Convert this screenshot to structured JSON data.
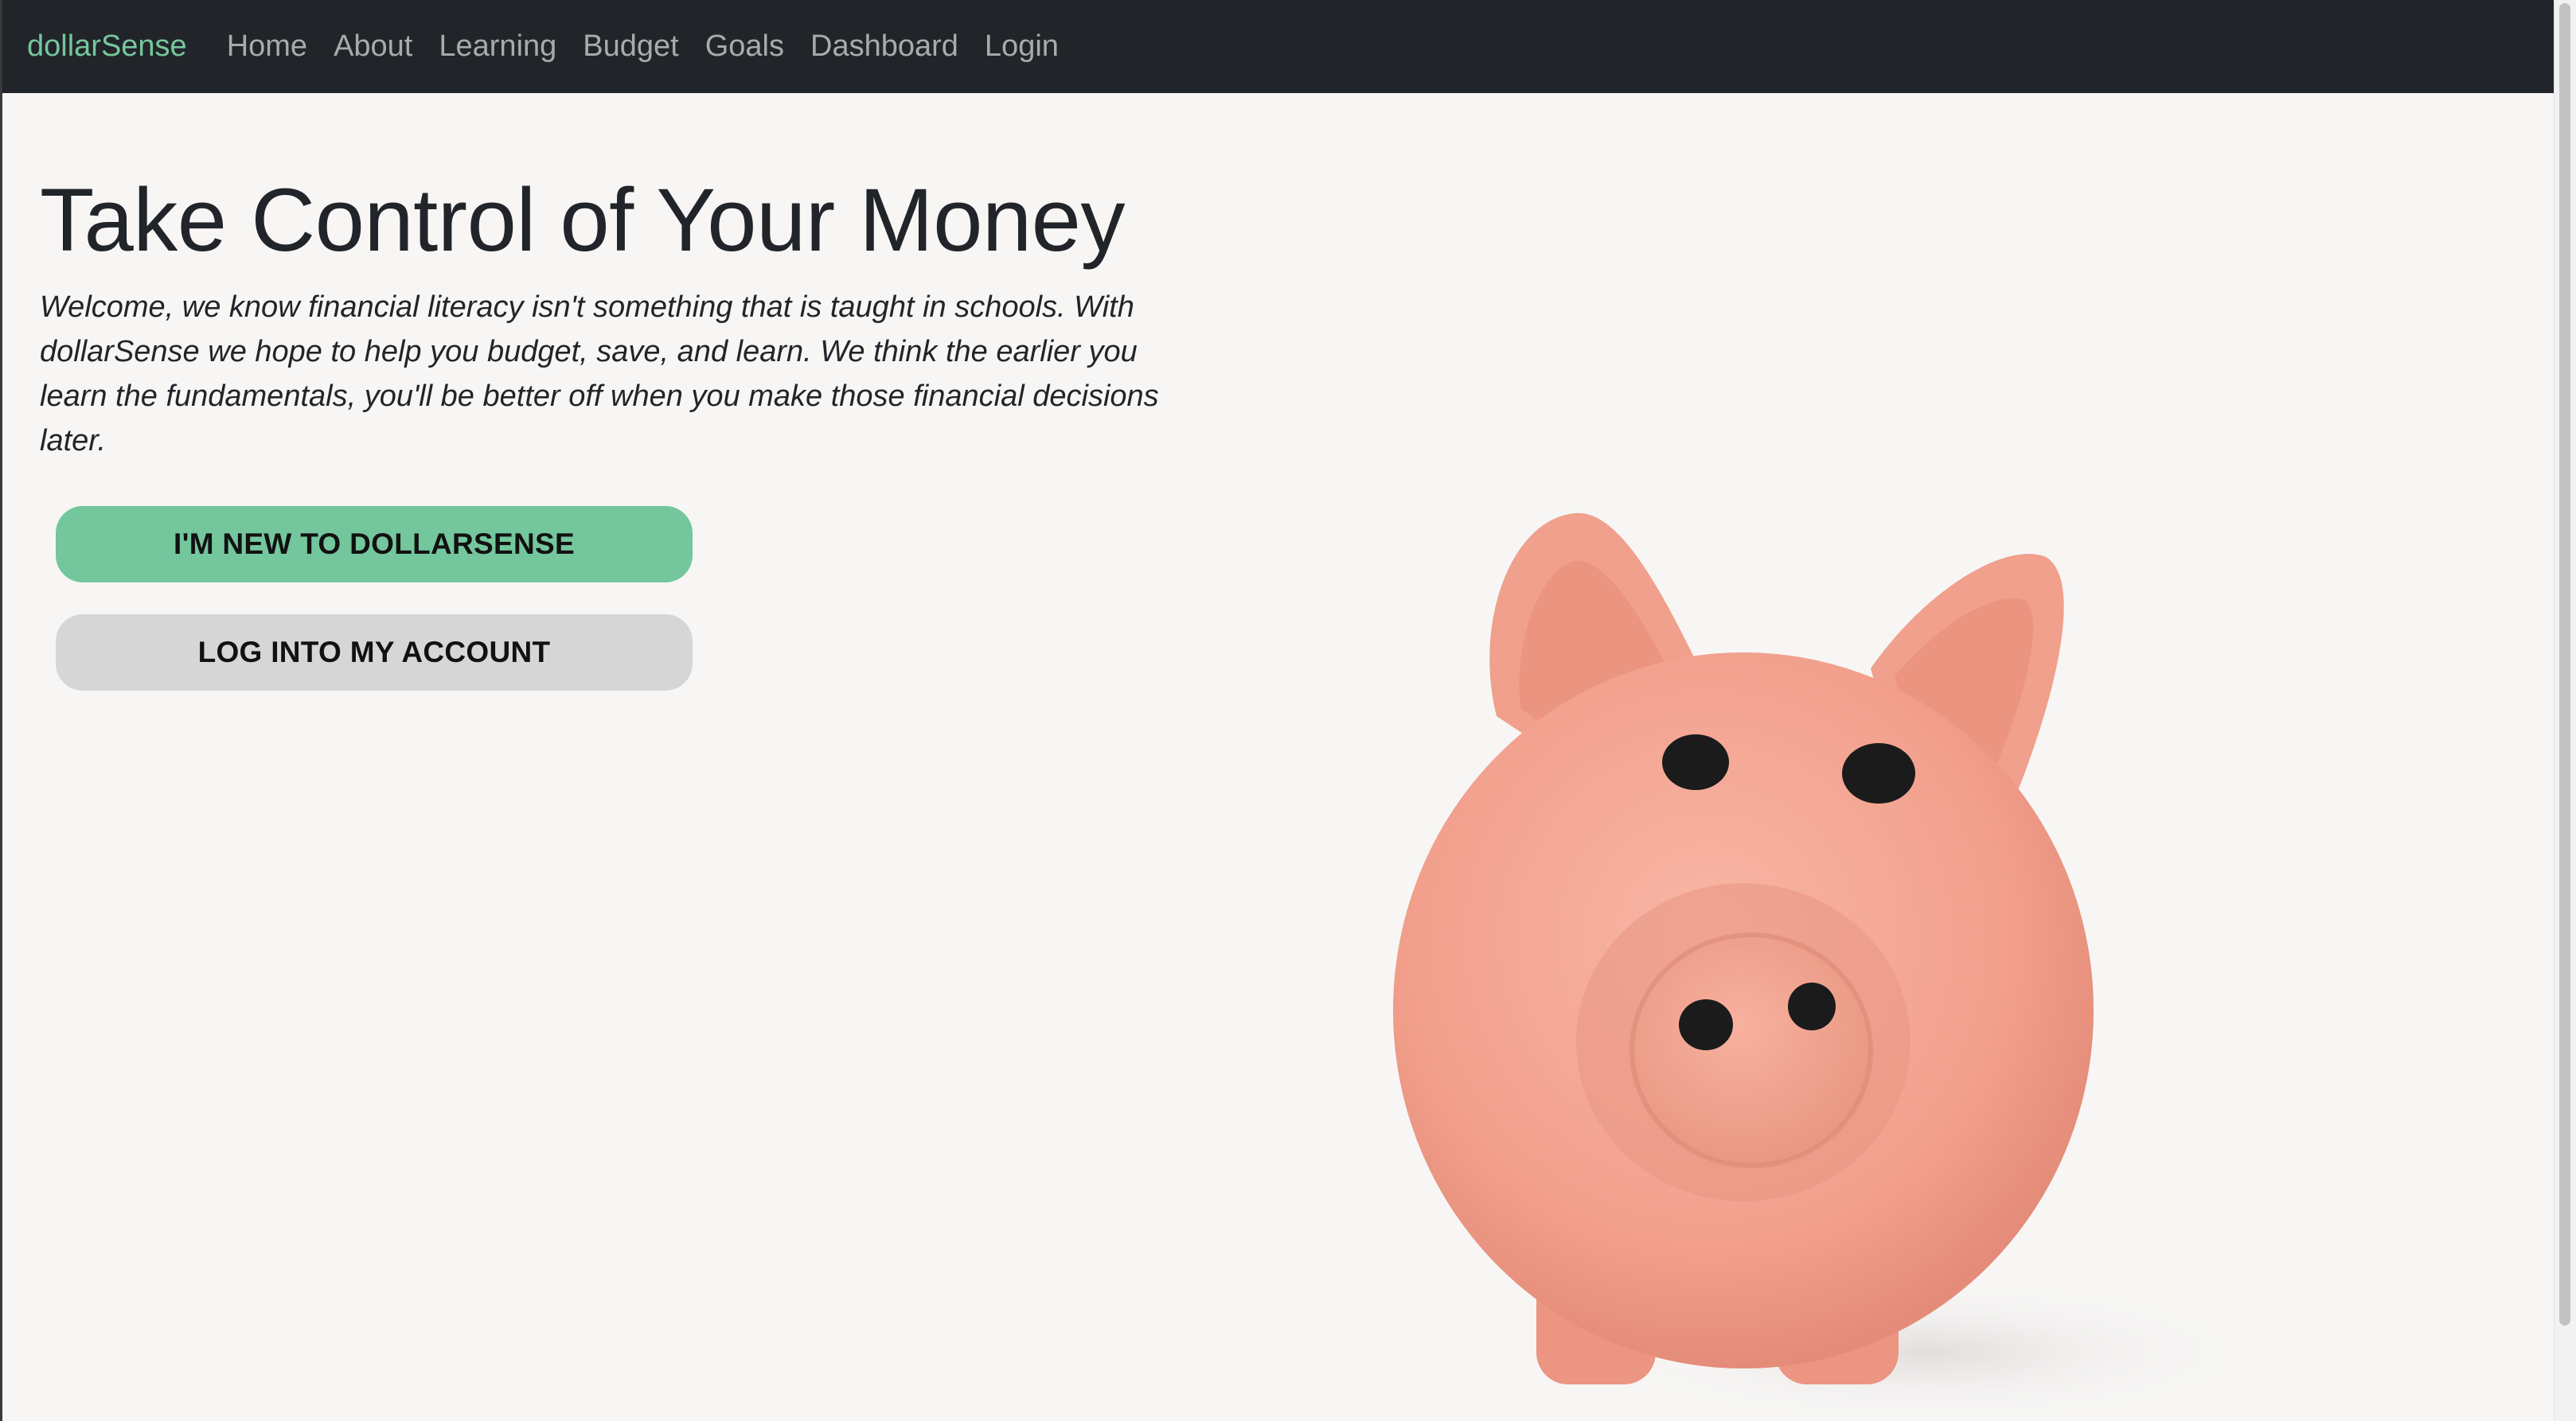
{
  "navbar": {
    "brand": "dollarSense",
    "links": [
      "Home",
      "About",
      "Learning",
      "Budget",
      "Goals",
      "Dashboard",
      "Login"
    ]
  },
  "hero": {
    "title": "Take Control of Your Money",
    "text": "Welcome, we know financial literacy isn't something that is taught in schools. With dollarSense we hope to help you budget, save, and learn. We think the earlier you learn the fundamentals, you'll be better off when you make those financial decisions later.",
    "buttons": {
      "new_user": "I'M NEW TO DOLLARSENSE",
      "login": "LOG INTO MY ACCOUNT"
    }
  },
  "colors": {
    "navbar_bg": "#212529",
    "brand": "#75c79d",
    "primary_button": "#74c69d",
    "secondary_button": "#d6d6d6",
    "piggy": "#f4a493"
  }
}
